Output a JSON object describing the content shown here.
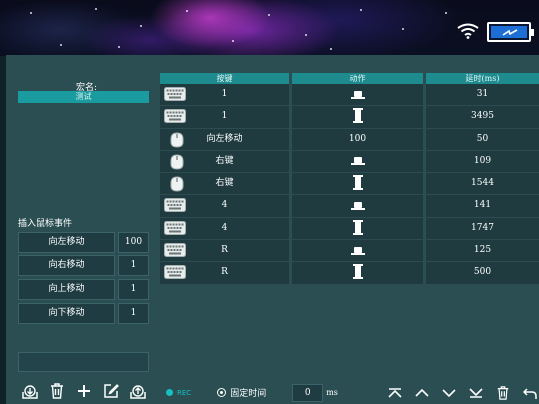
{
  "status_icons": [
    "wifi-icon",
    "battery-icon"
  ],
  "left": {
    "macro_name_label": "宏名:",
    "macro_name_value": "测试",
    "insert_mouse_label": "插入鼠标事件",
    "mouse_moves": [
      {
        "label": "向左移动",
        "value": "100"
      },
      {
        "label": "向右移动",
        "value": "1"
      },
      {
        "label": "向上移动",
        "value": "1"
      },
      {
        "label": "向下移动",
        "value": "1"
      }
    ],
    "toolbar_icons": [
      "import-icon",
      "trash-icon",
      "plus-icon",
      "edit-icon",
      "export-icon"
    ]
  },
  "table": {
    "headers": [
      "按键",
      "动作",
      "延时(ms)"
    ],
    "rows": [
      {
        "icon": "keyboard-icon",
        "key": "1",
        "action": "press-down",
        "action_text": "",
        "delay": "31"
      },
      {
        "icon": "keyboard-icon",
        "key": "1",
        "action": "release-up",
        "action_text": "",
        "delay": "3495"
      },
      {
        "icon": "mouse-icon",
        "key": "向左移动",
        "action": "text",
        "action_text": "100",
        "delay": "50"
      },
      {
        "icon": "mouse-icon",
        "key": "右键",
        "action": "press-down",
        "action_text": "",
        "delay": "109"
      },
      {
        "icon": "mouse-icon",
        "key": "右键",
        "action": "release-up",
        "action_text": "",
        "delay": "1544"
      },
      {
        "icon": "keyboard-icon",
        "key": "4",
        "action": "press-down",
        "action_text": "",
        "delay": "141"
      },
      {
        "icon": "keyboard-icon",
        "key": "4",
        "action": "release-up",
        "action_text": "",
        "delay": "1747"
      },
      {
        "icon": "keyboard-icon",
        "key": "R",
        "action": "press-down",
        "action_text": "",
        "delay": "125"
      },
      {
        "icon": "keyboard-icon",
        "key": "R",
        "action": "release-up",
        "action_text": "",
        "delay": "500"
      }
    ]
  },
  "bottom": {
    "rec_label": "REC",
    "fixed_time_label": "固定时间",
    "fixed_time_value": "0",
    "ms_label": "ms",
    "right_icons": [
      "move-top-icon",
      "move-up-icon",
      "move-down-icon",
      "move-bottom-icon",
      "trash-icon",
      "undo-icon"
    ]
  },
  "colors": {
    "panel_bg": "#2a4e52",
    "accent_teal": "#1e8b8f",
    "rec": "#17c0c0",
    "battery_fill": "#1d6fd6"
  }
}
